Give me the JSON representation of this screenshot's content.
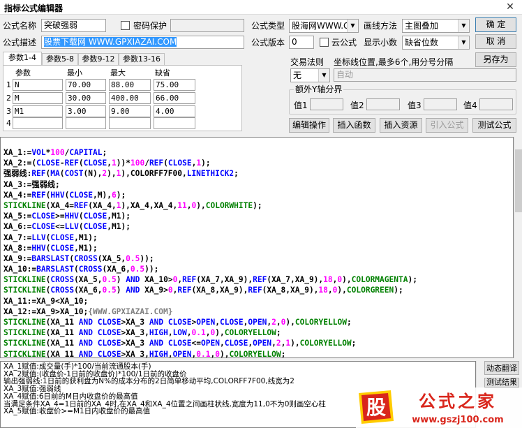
{
  "window": {
    "title": "指标公式编辑器",
    "close_glyph": "✕"
  },
  "form": {
    "name_label": "公式名称",
    "name_value": "突破强弱",
    "password_label": "密码保护",
    "desc_label": "公式描述",
    "desc_value": "股票下载网 WWW.GPXIAZAI.COM",
    "type_label": "公式类型",
    "type_value": "股海网WWW.GU",
    "draw_label": "画线方法",
    "draw_value": "主图叠加",
    "version_label": "公式版本",
    "version_value": "0",
    "cloud_label": "云公式",
    "decimal_label": "显示小数",
    "decimal_value": "缺省位数",
    "trade_label": "交易法则",
    "trade_value": "无",
    "coord_label": "坐标线位置,最多6个,用分号分隔",
    "coord_value": "自动",
    "yaxis_label": "额外Y轴分界",
    "yaxis_values": [
      "值1",
      "值2",
      "值3",
      "值4"
    ]
  },
  "buttons": {
    "ok": "确  定",
    "cancel": "取  消",
    "save_as": "另存为",
    "edit_op": "编辑操作",
    "insert_func": "插入函数",
    "insert_res": "插入资源",
    "import_formula": "引入公式",
    "test_formula": "测试公式",
    "dynamic_translate": "动态翻译",
    "test_result": "测试结果"
  },
  "tabs": [
    "参数1-4",
    "参数5-8",
    "参数9-12",
    "参数13-16"
  ],
  "params": {
    "headers": [
      "参数",
      "最小",
      "最大",
      "缺省"
    ],
    "rows": [
      {
        "idx": "1",
        "name": "N",
        "min": "70.00",
        "max": "88.00",
        "def": "75.00"
      },
      {
        "idx": "2",
        "name": "M",
        "min": "30.00",
        "max": "400.00",
        "def": "66.00"
      },
      {
        "idx": "3",
        "name": "M1",
        "min": "3.00",
        "max": "9.00",
        "def": "4.00"
      },
      {
        "idx": "4",
        "name": "",
        "min": "",
        "max": "",
        "def": ""
      }
    ]
  },
  "code_lines": [
    [
      [
        "XA_1:=",
        "#000000"
      ],
      [
        "VOL",
        "#0000ff"
      ],
      [
        "*",
        "#000000"
      ],
      [
        "100",
        "#ff00ff"
      ],
      [
        "/",
        "#000000"
      ],
      [
        "CAPITAL",
        "#0000ff"
      ],
      [
        ";",
        "#000000"
      ]
    ],
    [
      [
        "XA_2:=(",
        "#000000"
      ],
      [
        "CLOSE",
        "#0000ff"
      ],
      [
        "-",
        "#000000"
      ],
      [
        "REF",
        "#0000ff"
      ],
      [
        "(",
        "#000000"
      ],
      [
        "CLOSE",
        "#0000ff"
      ],
      [
        ",",
        "#000000"
      ],
      [
        "1",
        "#ff00ff"
      ],
      [
        "))*",
        "#000000"
      ],
      [
        "100",
        "#ff00ff"
      ],
      [
        "/",
        "#000000"
      ],
      [
        "REF",
        "#0000ff"
      ],
      [
        "(",
        "#000000"
      ],
      [
        "CLOSE",
        "#0000ff"
      ],
      [
        ",",
        "#000000"
      ],
      [
        "1",
        "#ff00ff"
      ],
      [
        ");",
        "#000000"
      ]
    ],
    [
      [
        "强弱线:",
        "#000000"
      ],
      [
        "REF",
        "#0000ff"
      ],
      [
        "(",
        "#000000"
      ],
      [
        "MA",
        "#0000ff"
      ],
      [
        "(",
        "#000000"
      ],
      [
        "COST",
        "#0000ff"
      ],
      [
        "(N),",
        "#000000"
      ],
      [
        "2",
        "#ff00ff"
      ],
      [
        "),",
        "#000000"
      ],
      [
        "1",
        "#ff00ff"
      ],
      [
        "),COLORFF7F00,",
        "#000000"
      ],
      [
        "LINETHICK2",
        "#0000ff"
      ],
      [
        ";",
        "#000000"
      ]
    ],
    [
      [
        "XA_3:=强弱线;",
        "#000000"
      ]
    ],
    [
      [
        "XA_4:=",
        "#000000"
      ],
      [
        "REF",
        "#0000ff"
      ],
      [
        "(",
        "#000000"
      ],
      [
        "HHV",
        "#0000ff"
      ],
      [
        "(",
        "#000000"
      ],
      [
        "CLOSE",
        "#0000ff"
      ],
      [
        ",M),",
        "#000000"
      ],
      [
        "6",
        "#ff00ff"
      ],
      [
        ");",
        "#000000"
      ]
    ],
    [
      [
        "STICKLINE",
        "#008000"
      ],
      [
        "(XA_4=",
        "#000000"
      ],
      [
        "REF",
        "#0000ff"
      ],
      [
        "(XA_4,",
        "#000000"
      ],
      [
        "1",
        "#ff00ff"
      ],
      [
        "),XA_4,XA_4,",
        "#000000"
      ],
      [
        "11",
        "#ff00ff"
      ],
      [
        ",",
        "#000000"
      ],
      [
        "0",
        "#ff00ff"
      ],
      [
        "),",
        "#000000"
      ],
      [
        "COLORWHITE",
        "#008000"
      ],
      [
        ");",
        "#000000"
      ]
    ],
    [
      [
        "XA_5:=",
        "#000000"
      ],
      [
        "CLOSE",
        "#0000ff"
      ],
      [
        ">=",
        "#000000"
      ],
      [
        "HHV",
        "#0000ff"
      ],
      [
        "(",
        "#000000"
      ],
      [
        "CLOSE",
        "#0000ff"
      ],
      [
        ",M1);",
        "#000000"
      ]
    ],
    [
      [
        "XA_6:=",
        "#000000"
      ],
      [
        "CLOSE",
        "#0000ff"
      ],
      [
        "<=",
        "#000000"
      ],
      [
        "LLV",
        "#0000ff"
      ],
      [
        "(",
        "#000000"
      ],
      [
        "CLOSE",
        "#0000ff"
      ],
      [
        ",M1);",
        "#000000"
      ]
    ],
    [
      [
        "XA_7:=",
        "#000000"
      ],
      [
        "LLV",
        "#0000ff"
      ],
      [
        "(",
        "#000000"
      ],
      [
        "CLOSE",
        "#0000ff"
      ],
      [
        ",M1);",
        "#000000"
      ]
    ],
    [
      [
        "XA_8:=",
        "#000000"
      ],
      [
        "HHV",
        "#0000ff"
      ],
      [
        "(",
        "#000000"
      ],
      [
        "CLOSE",
        "#0000ff"
      ],
      [
        ",M1);",
        "#000000"
      ]
    ],
    [
      [
        "XA_9:=",
        "#000000"
      ],
      [
        "BARSLAST",
        "#0000ff"
      ],
      [
        "(",
        "#000000"
      ],
      [
        "CROSS",
        "#0000ff"
      ],
      [
        "(XA_5,",
        "#000000"
      ],
      [
        "0.5",
        "#ff00ff"
      ],
      [
        "));",
        "#000000"
      ]
    ],
    [
      [
        "XA_10:=",
        "#000000"
      ],
      [
        "BARSLAST",
        "#0000ff"
      ],
      [
        "(",
        "#000000"
      ],
      [
        "CROSS",
        "#0000ff"
      ],
      [
        "(XA_6,",
        "#000000"
      ],
      [
        "0.5",
        "#ff00ff"
      ],
      [
        "));",
        "#000000"
      ]
    ],
    [
      [
        "STICKLINE",
        "#008000"
      ],
      [
        "(",
        "#000000"
      ],
      [
        "CROSS",
        "#0000ff"
      ],
      [
        "(XA_5,",
        "#000000"
      ],
      [
        "0.5",
        "#ff00ff"
      ],
      [
        ") ",
        "#000000"
      ],
      [
        "AND",
        "#0000ff"
      ],
      [
        " XA_10>",
        "#000000"
      ],
      [
        "0",
        "#ff00ff"
      ],
      [
        ",",
        "#000000"
      ],
      [
        "REF",
        "#0000ff"
      ],
      [
        "(XA_7,XA_9),",
        "#000000"
      ],
      [
        "REF",
        "#0000ff"
      ],
      [
        "(XA_7,XA_9),",
        "#000000"
      ],
      [
        "18",
        "#ff00ff"
      ],
      [
        ",",
        "#000000"
      ],
      [
        "0",
        "#ff00ff"
      ],
      [
        "),",
        "#000000"
      ],
      [
        "COLORMAGENTA",
        "#008000"
      ],
      [
        ");",
        "#000000"
      ]
    ],
    [
      [
        "STICKLINE",
        "#008000"
      ],
      [
        "(",
        "#000000"
      ],
      [
        "CROSS",
        "#0000ff"
      ],
      [
        "(XA_6,",
        "#000000"
      ],
      [
        "0.5",
        "#ff00ff"
      ],
      [
        ") ",
        "#000000"
      ],
      [
        "AND",
        "#0000ff"
      ],
      [
        " XA_9>",
        "#000000"
      ],
      [
        "0",
        "#ff00ff"
      ],
      [
        ",",
        "#000000"
      ],
      [
        "REF",
        "#0000ff"
      ],
      [
        "(XA_8,XA_9),",
        "#000000"
      ],
      [
        "REF",
        "#0000ff"
      ],
      [
        "(XA_8,XA_9),",
        "#000000"
      ],
      [
        "18",
        "#ff00ff"
      ],
      [
        ",",
        "#000000"
      ],
      [
        "0",
        "#ff00ff"
      ],
      [
        "),",
        "#000000"
      ],
      [
        "COLORGREEN",
        "#008000"
      ],
      [
        ");",
        "#000000"
      ]
    ],
    [
      [
        "XA_11:=XA_9<XA_10;",
        "#000000"
      ]
    ],
    [
      [
        "XA_12:=XA_9>XA_10;",
        "#000000"
      ],
      [
        "{WWW.GPXIAZAI.COM}",
        "#808080"
      ]
    ],
    [
      [
        "STICKLINE",
        "#008000"
      ],
      [
        "(XA_11 ",
        "#000000"
      ],
      [
        "AND",
        "#0000ff"
      ],
      [
        " ",
        "#000000"
      ],
      [
        "CLOSE",
        "#0000ff"
      ],
      [
        ">XA_3 ",
        "#000000"
      ],
      [
        "AND",
        "#0000ff"
      ],
      [
        " ",
        "#000000"
      ],
      [
        "CLOSE",
        "#0000ff"
      ],
      [
        ">",
        "#000000"
      ],
      [
        "OPEN",
        "#0000ff"
      ],
      [
        ",",
        "#000000"
      ],
      [
        "CLOSE",
        "#0000ff"
      ],
      [
        ",",
        "#000000"
      ],
      [
        "OPEN",
        "#0000ff"
      ],
      [
        ",",
        "#000000"
      ],
      [
        "2",
        "#ff00ff"
      ],
      [
        ",",
        "#000000"
      ],
      [
        "0",
        "#ff00ff"
      ],
      [
        "),",
        "#000000"
      ],
      [
        "COLORYELLOW",
        "#008000"
      ],
      [
        ";",
        "#000000"
      ]
    ],
    [
      [
        "STICKLINE",
        "#008000"
      ],
      [
        "(XA_11 ",
        "#000000"
      ],
      [
        "AND",
        "#0000ff"
      ],
      [
        " ",
        "#000000"
      ],
      [
        "CLOSE",
        "#0000ff"
      ],
      [
        ">XA_3,",
        "#000000"
      ],
      [
        "HIGH",
        "#0000ff"
      ],
      [
        ",",
        "#000000"
      ],
      [
        "LOW",
        "#0000ff"
      ],
      [
        ",",
        "#000000"
      ],
      [
        "0.1",
        "#ff00ff"
      ],
      [
        ",",
        "#000000"
      ],
      [
        "0",
        "#ff00ff"
      ],
      [
        "),",
        "#000000"
      ],
      [
        "COLORYELLOW",
        "#008000"
      ],
      [
        ";",
        "#000000"
      ]
    ],
    [
      [
        "STICKLINE",
        "#008000"
      ],
      [
        "(XA_11 ",
        "#000000"
      ],
      [
        "AND",
        "#0000ff"
      ],
      [
        " ",
        "#000000"
      ],
      [
        "CLOSE",
        "#0000ff"
      ],
      [
        ">XA_3 ",
        "#000000"
      ],
      [
        "AND",
        "#0000ff"
      ],
      [
        " ",
        "#000000"
      ],
      [
        "CLOSE",
        "#0000ff"
      ],
      [
        "<=",
        "#000000"
      ],
      [
        "OPEN",
        "#0000ff"
      ],
      [
        ",",
        "#000000"
      ],
      [
        "CLOSE",
        "#0000ff"
      ],
      [
        ",",
        "#000000"
      ],
      [
        "OPEN",
        "#0000ff"
      ],
      [
        ",",
        "#000000"
      ],
      [
        "2",
        "#ff00ff"
      ],
      [
        ",",
        "#000000"
      ],
      [
        "1",
        "#ff00ff"
      ],
      [
        "),",
        "#000000"
      ],
      [
        "COLORYELLOW",
        "#008000"
      ],
      [
        ";",
        "#000000"
      ]
    ],
    [
      [
        "STICKLINE",
        "#008000"
      ],
      [
        "(XA_11 ",
        "#000000"
      ],
      [
        "AND",
        "#0000ff"
      ],
      [
        " ",
        "#000000"
      ],
      [
        "CLOSE",
        "#0000ff"
      ],
      [
        ">XA_3,",
        "#000000"
      ],
      [
        "HIGH",
        "#0000ff"
      ],
      [
        ",",
        "#000000"
      ],
      [
        "OPEN",
        "#0000ff"
      ],
      [
        ",",
        "#000000"
      ],
      [
        "0.1",
        "#ff00ff"
      ],
      [
        ",",
        "#000000"
      ],
      [
        "0",
        "#ff00ff"
      ],
      [
        "),",
        "#000000"
      ],
      [
        "COLORYELLOW",
        "#008000"
      ],
      [
        ";",
        "#000000"
      ]
    ]
  ],
  "output_lines": [
    "XA_1赋值:成交量(手)*100/当前流通股本(手)",
    "XA_2赋值:(收盘价-1日前的收盘价)*100/1日前的收盘价",
    "输出强弱线:1日前的获利盘为N%的成本分布的2日简单移动平均,COLORFF7F00,线宽为2",
    "XA_3赋值:强弱线",
    "XA_4赋值:6日前的M日内收盘价的最高值",
    "当满足条件XA_4=1日前的XA_4时,在XA_4和XA_4位置之间画柱状线,宽度为11,0不为0则画空心柱",
    "XA_5赋值:收盘价>=M1日内收盘价的最高值"
  ],
  "watermark": {
    "logo_char": "股",
    "brand": "公式之家",
    "site": "www.gszj100.com"
  },
  "colors": {
    "keyword_blue": "#0000ff",
    "number_magenta": "#ff00ff",
    "draw_green": "#008000",
    "selection": "#3399ff",
    "logo_red": "#d9261c"
  }
}
